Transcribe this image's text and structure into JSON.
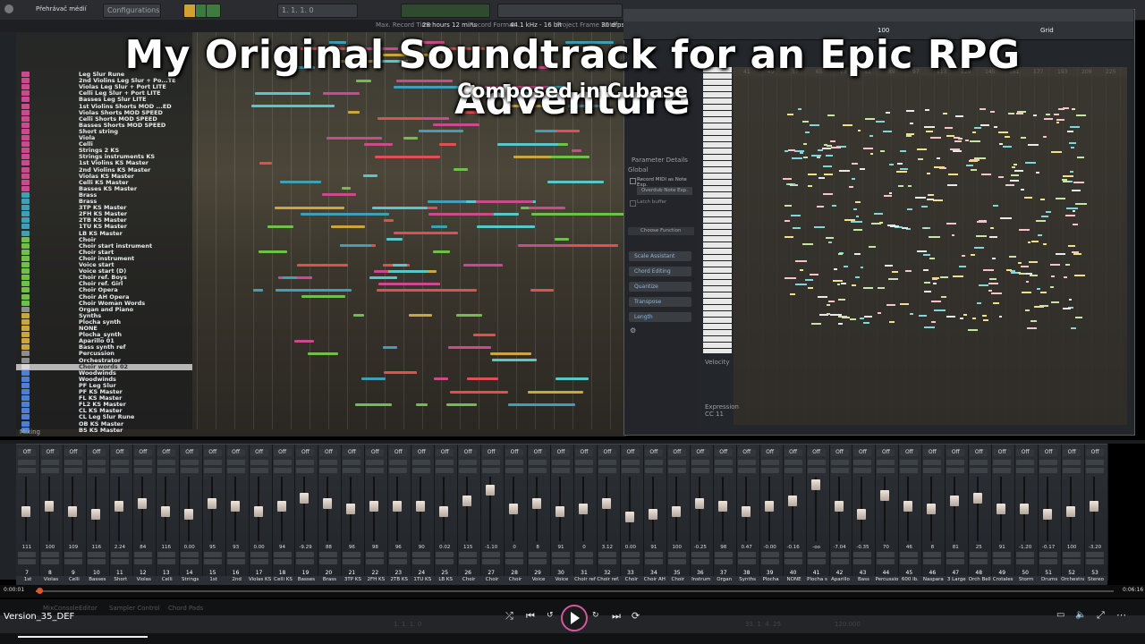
{
  "window": {
    "title": "Přehrávač médií"
  },
  "overlay": {
    "title": "My Original Soundtrack for an Epic RPG Adventure",
    "subtitle": "Composed in Cubase"
  },
  "toolbar": {
    "configurations": "Configurations",
    "position": "1. 1. 1. 0",
    "info_max_record": "Max. Record Time",
    "info_record_time": "28 hours 12 mins",
    "info_record_format": "Record Format",
    "info_format_value": "44.1 kHz - 16 bit",
    "info_frame_rate": "Project Frame Rate",
    "info_fps": "30 dfps"
  },
  "tracks": [
    {
      "name": "Leg Slur Rune",
      "color": "#c94b8e"
    },
    {
      "name": "2nd Violins Leg Slur + Po...TE",
      "color": "#c94b8e"
    },
    {
      "name": "Violas Leg Slur + Port LITE",
      "color": "#c94b8e"
    },
    {
      "name": "Celli Leg Slur + Port LITE",
      "color": "#c94b8e"
    },
    {
      "name": "Basses Leg Slur LITE",
      "color": "#c94b8e"
    },
    {
      "name": "1st Violins Shorts MOD ...ED",
      "color": "#c94b8e"
    },
    {
      "name": "Violas Shorts MOD SPEED",
      "color": "#c94b8e"
    },
    {
      "name": "Celli Shorts MOD SPEED",
      "color": "#c94b8e"
    },
    {
      "name": "Basses Shorts MOD SPEED",
      "color": "#c94b8e"
    },
    {
      "name": "Short string",
      "color": "#c94b8e"
    },
    {
      "name": "Viola",
      "color": "#c94b8e"
    },
    {
      "name": "Celli",
      "color": "#c94b8e"
    },
    {
      "name": "Strings 2 KS",
      "color": "#c94b8e"
    },
    {
      "name": "Strings instruments KS",
      "color": "#c94b8e"
    },
    {
      "name": "1st Violins KS Master",
      "color": "#c94b8e"
    },
    {
      "name": "2nd Violins KS Master",
      "color": "#c94b8e"
    },
    {
      "name": "Violas KS Master",
      "color": "#c94b8e"
    },
    {
      "name": "Celli KS Master",
      "color": "#c94b8e"
    },
    {
      "name": "Basses KS Master",
      "color": "#c94b8e"
    },
    {
      "name": "Brass",
      "color": "#3fa0b5"
    },
    {
      "name": "Brass",
      "color": "#3fa0b5"
    },
    {
      "name": "3TP KS Master",
      "color": "#3fa0b5"
    },
    {
      "name": "2FH KS Master",
      "color": "#3fa0b5"
    },
    {
      "name": "2TB KS Master",
      "color": "#3fa0b5"
    },
    {
      "name": "1TU KS Master",
      "color": "#3fa0b5"
    },
    {
      "name": "LB KS Master",
      "color": "#3fa0b5"
    },
    {
      "name": "Choir",
      "color": "#6fbf4a"
    },
    {
      "name": "Choir start instrument",
      "color": "#6fbf4a"
    },
    {
      "name": "Choir start",
      "color": "#6fbf4a"
    },
    {
      "name": "Choir instrument",
      "color": "#6fbf4a"
    },
    {
      "name": "Voice start",
      "color": "#6fbf4a"
    },
    {
      "name": "Voice start (D)",
      "color": "#6fbf4a"
    },
    {
      "name": "Choir ref. Boys",
      "color": "#6fbf4a"
    },
    {
      "name": "Choir ref. Girl",
      "color": "#6fbf4a"
    },
    {
      "name": "Choir Opera",
      "color": "#6fbf4a"
    },
    {
      "name": "Choir AH Opera",
      "color": "#6fbf4a"
    },
    {
      "name": "Choir Woman Words",
      "color": "#6fbf4a"
    },
    {
      "name": "Organ and Piano",
      "color": "#8d8d8d"
    },
    {
      "name": "Synths",
      "color": "#c9a63e"
    },
    {
      "name": "Plocha synth",
      "color": "#c9a63e"
    },
    {
      "name": "NONE",
      "color": "#c9a63e"
    },
    {
      "name": "Plocha_synth",
      "color": "#c9a63e"
    },
    {
      "name": "Aparillo 01",
      "color": "#c9a63e"
    },
    {
      "name": "Bass synth ref",
      "color": "#c9a63e"
    },
    {
      "name": "Percussion",
      "color": "#8d8d8d"
    },
    {
      "name": "Orchestrator",
      "color": "#8d8d8d"
    },
    {
      "name": "Choir words 02",
      "color": "#d9d9d9"
    },
    {
      "name": "Woodwinds",
      "color": "#4f7fd1"
    },
    {
      "name": "Woodwinds",
      "color": "#4f7fd1"
    },
    {
      "name": "PF Leg Slur",
      "color": "#4f7fd1"
    },
    {
      "name": "PF KS Master",
      "color": "#4f7fd1"
    },
    {
      "name": "FL KS Master",
      "color": "#4f7fd1"
    },
    {
      "name": "FL2 KS Master",
      "color": "#4f7fd1"
    },
    {
      "name": "CL KS Master",
      "color": "#4f7fd1"
    },
    {
      "name": "CL Leg Slur Rune",
      "color": "#4f7fd1"
    },
    {
      "name": "OB KS Master",
      "color": "#4f7fd1"
    },
    {
      "name": "BS KS Master",
      "color": "#4f7fd1"
    }
  ],
  "tracklist_footer": {
    "label": "Mixing"
  },
  "key_editor": {
    "panel_title": "Parameter Details",
    "global": "Global",
    "record_midi": "Record MIDI as Note Exp.",
    "overdub": "Overdub Note Exp.",
    "latch_buffer": "Latch buffer",
    "choose_function": "Choose Function",
    "sections": [
      "Scale Assistant",
      "Chord Editing",
      "Quantize",
      "Transpose",
      "Length"
    ],
    "lane_velocity": "Velocity",
    "lane_expression": "Expression",
    "lane_cc": "CC 11",
    "zoom": "100",
    "snap": "Grid",
    "ruler_ticks": [
      "41",
      "49",
      "57",
      "65",
      "73",
      "81",
      "89",
      "97",
      "113",
      "129",
      "145",
      "161",
      "177",
      "193",
      "209",
      "225"
    ]
  },
  "mixer": {
    "channels": [
      {
        "num": "7",
        "name": "1st",
        "val": "111",
        "fader": 0.45
      },
      {
        "num": "8",
        "name": "Violas",
        "val": "100",
        "fader": 0.55
      },
      {
        "num": "9",
        "name": "Celli",
        "val": "109",
        "fader": 0.45
      },
      {
        "num": "10",
        "name": "Basses",
        "val": "116",
        "fader": 0.4
      },
      {
        "num": "11",
        "name": "Short",
        "val": "2.24",
        "fader": 0.55
      },
      {
        "num": "12",
        "name": "Violas",
        "val": "84",
        "fader": 0.6
      },
      {
        "num": "13",
        "name": "Celli",
        "val": "116",
        "fader": 0.45
      },
      {
        "num": "14",
        "name": "Strings",
        "val": "0.00",
        "fader": 0.4
      },
      {
        "num": "15",
        "name": "1st",
        "val": "95",
        "fader": 0.6
      },
      {
        "num": "16",
        "name": "2nd",
        "val": "93",
        "fader": 0.55
      },
      {
        "num": "17",
        "name": "Violas KS",
        "val": "0.00",
        "fader": 0.45
      },
      {
        "num": "18",
        "name": "Celli KS",
        "val": "94",
        "fader": 0.55
      },
      {
        "num": "19",
        "name": "Basses",
        "val": "-9.29",
        "fader": 0.7
      },
      {
        "num": "20",
        "name": "Brass",
        "val": "88",
        "fader": 0.6
      },
      {
        "num": "21",
        "name": "3TP KS",
        "val": "96",
        "fader": 0.5
      },
      {
        "num": "22",
        "name": "2FH KS",
        "val": "98",
        "fader": 0.55
      },
      {
        "num": "23",
        "name": "2TB KS",
        "val": "96",
        "fader": 0.55
      },
      {
        "num": "24",
        "name": "1TU KS",
        "val": "90",
        "fader": 0.55
      },
      {
        "num": "25",
        "name": "LB KS",
        "val": "0.02",
        "fader": 0.45
      },
      {
        "num": "26",
        "name": "Choir",
        "val": "115",
        "fader": 0.65
      },
      {
        "num": "27",
        "name": "Choir",
        "val": "-1.10",
        "fader": 0.85
      },
      {
        "num": "28",
        "name": "Choir",
        "val": "0",
        "fader": 0.5
      },
      {
        "num": "29",
        "name": "Voice",
        "val": "8",
        "fader": 0.6
      },
      {
        "num": "30",
        "name": "Voice",
        "val": "91",
        "fader": 0.45
      },
      {
        "num": "31",
        "name": "Choir ref",
        "val": "0",
        "fader": 0.5
      },
      {
        "num": "32",
        "name": "Choir ref.",
        "val": "3.12",
        "fader": 0.6
      },
      {
        "num": "33",
        "name": "Choir",
        "val": "0.00",
        "fader": 0.35
      },
      {
        "num": "34",
        "name": "Choir AH",
        "val": "91",
        "fader": 0.4
      },
      {
        "num": "35",
        "name": "Choir",
        "val": "100",
        "fader": 0.45
      },
      {
        "num": "36",
        "name": "Instrum",
        "val": "-0.25",
        "fader": 0.6
      },
      {
        "num": "37",
        "name": "Organ",
        "val": "98",
        "fader": 0.55
      },
      {
        "num": "38",
        "name": "Synths",
        "val": "0.47",
        "fader": 0.45
      },
      {
        "num": "39",
        "name": "Plocha",
        "val": "-0.00",
        "fader": 0.55
      },
      {
        "num": "40",
        "name": "NONE",
        "val": "-0.16",
        "fader": 0.65
      },
      {
        "num": "41",
        "name": "Plocha s",
        "val": "-oo",
        "fader": 0.95
      },
      {
        "num": "42",
        "name": "Aparillo",
        "val": "-7.04",
        "fader": 0.55
      },
      {
        "num": "43",
        "name": "Bass",
        "val": "-0.35",
        "fader": 0.4
      },
      {
        "num": "44",
        "name": "Percussio",
        "val": "70",
        "fader": 0.75
      },
      {
        "num": "45",
        "name": "600 lb.",
        "val": "46",
        "fader": 0.55
      },
      {
        "num": "46",
        "name": "Naspara",
        "val": "8",
        "fader": 0.5
      },
      {
        "num": "47",
        "name": "3 Large",
        "val": "81",
        "fader": 0.65
      },
      {
        "num": "48",
        "name": "Orch Bell",
        "val": "25",
        "fader": 0.7
      },
      {
        "num": "49",
        "name": "Crotales",
        "val": "91",
        "fader": 0.5
      },
      {
        "num": "50",
        "name": "Storm",
        "val": "-1.20",
        "fader": 0.5
      },
      {
        "num": "51",
        "name": "Drums",
        "val": "-0.17",
        "fader": 0.4
      },
      {
        "num": "52",
        "name": "Orchestra",
        "val": "100",
        "fader": 0.45
      },
      {
        "num": "53",
        "name": "Stereo",
        "val": "-3.20",
        "fader": 0.55
      }
    ],
    "off_label": "Off"
  },
  "timeline": {
    "elapsed": "0:00:01",
    "total": "0:06:16",
    "progress": 0.003
  },
  "bottom": {
    "file": "Version_35_DEF",
    "tabs": [
      "MixConsole",
      "Editor",
      "Sampler Control",
      "Chord Pads"
    ],
    "left_pos": "1. 1. 1. 0",
    "right_pos": "33. 1. 4. 25",
    "tempo": "120.000"
  }
}
